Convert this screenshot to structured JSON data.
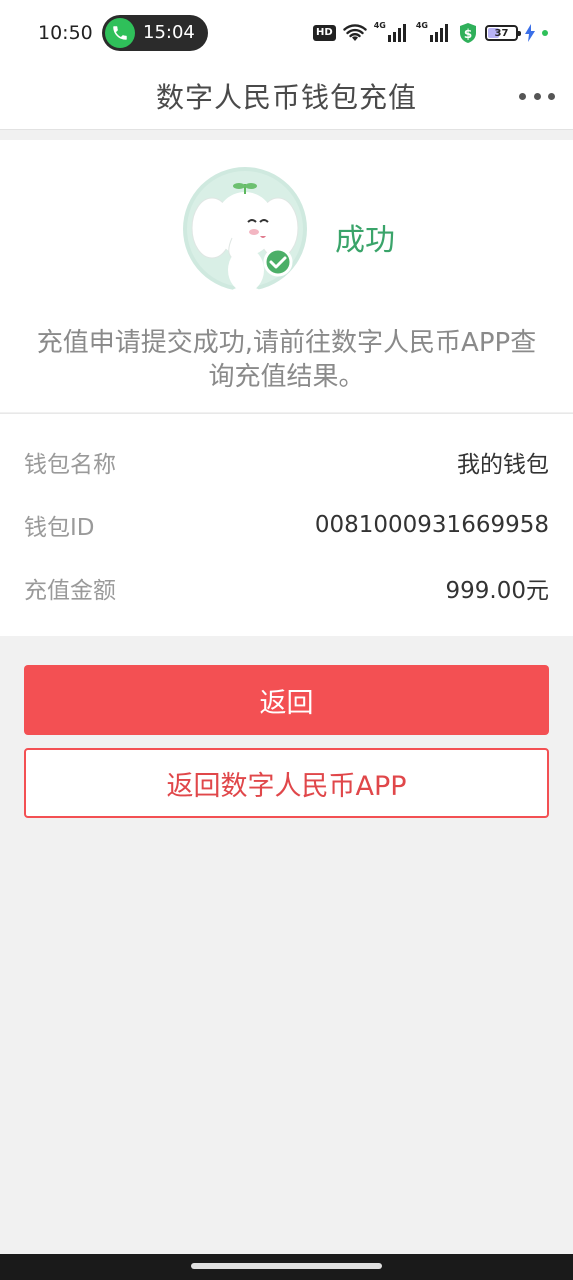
{
  "status_bar": {
    "time": "10:50",
    "call_timer": "15:04",
    "hd_label": "HD",
    "network_1": "4G",
    "network_2": "4G",
    "battery_level": "37",
    "battery_fraction": 0.37,
    "shield_symbol": "$",
    "colors": {
      "call_green": "#2fc05a",
      "shield_green": "#2fb05a"
    }
  },
  "header": {
    "title": "数字人民币钱包充值",
    "more_icon": "more-dots-icon"
  },
  "result": {
    "status": "成功",
    "message": "充值申请提交成功,请前往数字人民币APP查询充值结果。",
    "mascot_icon": "elephant-mascot-success-icon",
    "status_color": "#3aa46a"
  },
  "details": [
    {
      "label": "钱包名称",
      "value": "我的钱包"
    },
    {
      "label": "钱包ID",
      "value": "0081000931669958"
    },
    {
      "label": "充值金额",
      "value": "999.00元"
    }
  ],
  "actions": {
    "return_label": "返回",
    "return_app_label": "返回数字人民币APP",
    "accent_color": "#f35053"
  }
}
